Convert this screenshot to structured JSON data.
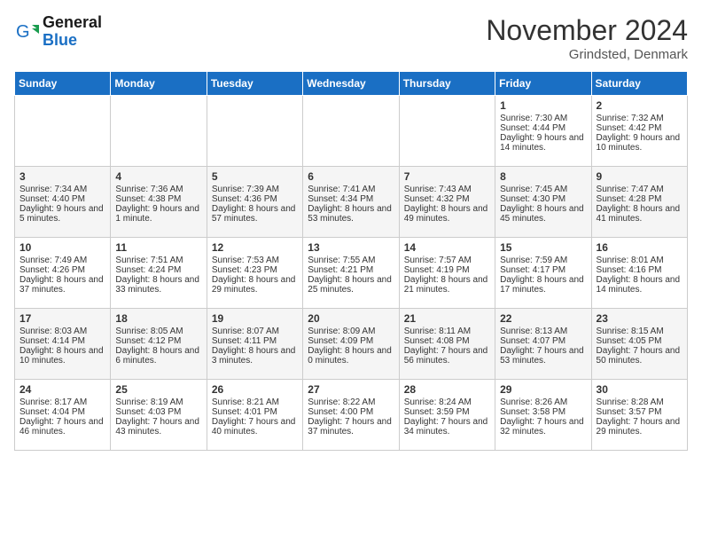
{
  "header": {
    "logo_line1": "General",
    "logo_line2": "Blue",
    "month_title": "November 2024",
    "location": "Grindsted, Denmark"
  },
  "days_of_week": [
    "Sunday",
    "Monday",
    "Tuesday",
    "Wednesday",
    "Thursday",
    "Friday",
    "Saturday"
  ],
  "weeks": [
    [
      {
        "day": "",
        "data": ""
      },
      {
        "day": "",
        "data": ""
      },
      {
        "day": "",
        "data": ""
      },
      {
        "day": "",
        "data": ""
      },
      {
        "day": "",
        "data": ""
      },
      {
        "day": "1",
        "data": "Sunrise: 7:30 AM\nSunset: 4:44 PM\nDaylight: 9 hours and 14 minutes."
      },
      {
        "day": "2",
        "data": "Sunrise: 7:32 AM\nSunset: 4:42 PM\nDaylight: 9 hours and 10 minutes."
      }
    ],
    [
      {
        "day": "3",
        "data": "Sunrise: 7:34 AM\nSunset: 4:40 PM\nDaylight: 9 hours and 5 minutes."
      },
      {
        "day": "4",
        "data": "Sunrise: 7:36 AM\nSunset: 4:38 PM\nDaylight: 9 hours and 1 minute."
      },
      {
        "day": "5",
        "data": "Sunrise: 7:39 AM\nSunset: 4:36 PM\nDaylight: 8 hours and 57 minutes."
      },
      {
        "day": "6",
        "data": "Sunrise: 7:41 AM\nSunset: 4:34 PM\nDaylight: 8 hours and 53 minutes."
      },
      {
        "day": "7",
        "data": "Sunrise: 7:43 AM\nSunset: 4:32 PM\nDaylight: 8 hours and 49 minutes."
      },
      {
        "day": "8",
        "data": "Sunrise: 7:45 AM\nSunset: 4:30 PM\nDaylight: 8 hours and 45 minutes."
      },
      {
        "day": "9",
        "data": "Sunrise: 7:47 AM\nSunset: 4:28 PM\nDaylight: 8 hours and 41 minutes."
      }
    ],
    [
      {
        "day": "10",
        "data": "Sunrise: 7:49 AM\nSunset: 4:26 PM\nDaylight: 8 hours and 37 minutes."
      },
      {
        "day": "11",
        "data": "Sunrise: 7:51 AM\nSunset: 4:24 PM\nDaylight: 8 hours and 33 minutes."
      },
      {
        "day": "12",
        "data": "Sunrise: 7:53 AM\nSunset: 4:23 PM\nDaylight: 8 hours and 29 minutes."
      },
      {
        "day": "13",
        "data": "Sunrise: 7:55 AM\nSunset: 4:21 PM\nDaylight: 8 hours and 25 minutes."
      },
      {
        "day": "14",
        "data": "Sunrise: 7:57 AM\nSunset: 4:19 PM\nDaylight: 8 hours and 21 minutes."
      },
      {
        "day": "15",
        "data": "Sunrise: 7:59 AM\nSunset: 4:17 PM\nDaylight: 8 hours and 17 minutes."
      },
      {
        "day": "16",
        "data": "Sunrise: 8:01 AM\nSunset: 4:16 PM\nDaylight: 8 hours and 14 minutes."
      }
    ],
    [
      {
        "day": "17",
        "data": "Sunrise: 8:03 AM\nSunset: 4:14 PM\nDaylight: 8 hours and 10 minutes."
      },
      {
        "day": "18",
        "data": "Sunrise: 8:05 AM\nSunset: 4:12 PM\nDaylight: 8 hours and 6 minutes."
      },
      {
        "day": "19",
        "data": "Sunrise: 8:07 AM\nSunset: 4:11 PM\nDaylight: 8 hours and 3 minutes."
      },
      {
        "day": "20",
        "data": "Sunrise: 8:09 AM\nSunset: 4:09 PM\nDaylight: 8 hours and 0 minutes."
      },
      {
        "day": "21",
        "data": "Sunrise: 8:11 AM\nSunset: 4:08 PM\nDaylight: 7 hours and 56 minutes."
      },
      {
        "day": "22",
        "data": "Sunrise: 8:13 AM\nSunset: 4:07 PM\nDaylight: 7 hours and 53 minutes."
      },
      {
        "day": "23",
        "data": "Sunrise: 8:15 AM\nSunset: 4:05 PM\nDaylight: 7 hours and 50 minutes."
      }
    ],
    [
      {
        "day": "24",
        "data": "Sunrise: 8:17 AM\nSunset: 4:04 PM\nDaylight: 7 hours and 46 minutes."
      },
      {
        "day": "25",
        "data": "Sunrise: 8:19 AM\nSunset: 4:03 PM\nDaylight: 7 hours and 43 minutes."
      },
      {
        "day": "26",
        "data": "Sunrise: 8:21 AM\nSunset: 4:01 PM\nDaylight: 7 hours and 40 minutes."
      },
      {
        "day": "27",
        "data": "Sunrise: 8:22 AM\nSunset: 4:00 PM\nDaylight: 7 hours and 37 minutes."
      },
      {
        "day": "28",
        "data": "Sunrise: 8:24 AM\nSunset: 3:59 PM\nDaylight: 7 hours and 34 minutes."
      },
      {
        "day": "29",
        "data": "Sunrise: 8:26 AM\nSunset: 3:58 PM\nDaylight: 7 hours and 32 minutes."
      },
      {
        "day": "30",
        "data": "Sunrise: 8:28 AM\nSunset: 3:57 PM\nDaylight: 7 hours and 29 minutes."
      }
    ]
  ]
}
